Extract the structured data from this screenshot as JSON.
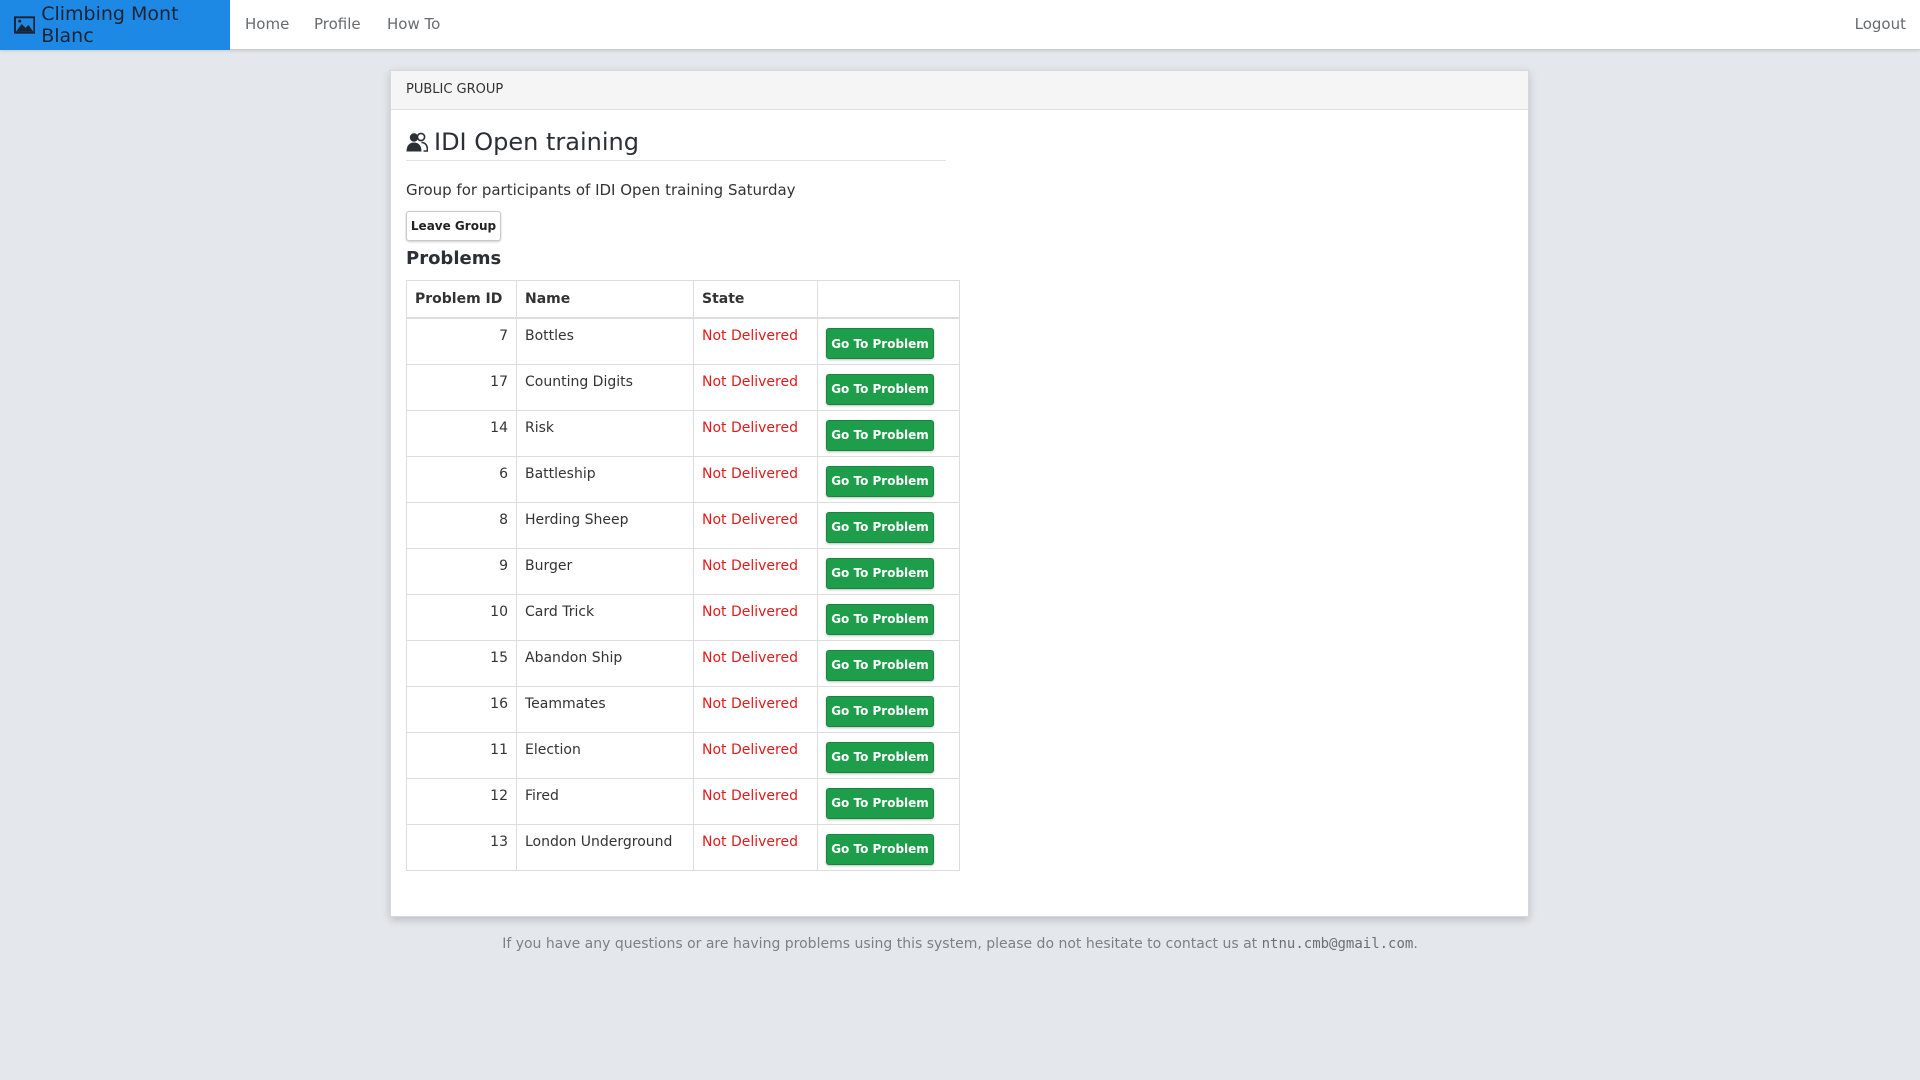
{
  "navbar": {
    "brand": "Climbing Mont Blanc",
    "brand_icon": "image-icon",
    "links": {
      "home": "Home",
      "profile": "Profile",
      "howto": "How To",
      "logout": "Logout"
    }
  },
  "panel": {
    "header": "PUBLIC GROUP",
    "title": "IDI Open training",
    "title_icon": "users-icon",
    "description": "Group for participants of IDI Open training Saturday",
    "leave_button": "Leave Group",
    "problems_heading": "Problems",
    "table": {
      "columns": [
        "Problem ID",
        "Name",
        "State",
        ""
      ],
      "action_label": "Go To Problem",
      "rows": [
        {
          "id": "7",
          "name": "Bottles",
          "state": "Not Delivered"
        },
        {
          "id": "17",
          "name": "Counting Digits",
          "state": "Not Delivered"
        },
        {
          "id": "14",
          "name": "Risk",
          "state": "Not Delivered"
        },
        {
          "id": "6",
          "name": "Battleship",
          "state": "Not Delivered"
        },
        {
          "id": "8",
          "name": "Herding Sheep",
          "state": "Not Delivered"
        },
        {
          "id": "9",
          "name": "Burger",
          "state": "Not Delivered"
        },
        {
          "id": "10",
          "name": "Card Trick",
          "state": "Not Delivered"
        },
        {
          "id": "15",
          "name": "Abandon Ship",
          "state": "Not Delivered"
        },
        {
          "id": "16",
          "name": "Teammates",
          "state": "Not Delivered"
        },
        {
          "id": "11",
          "name": "Election",
          "state": "Not Delivered"
        },
        {
          "id": "12",
          "name": "Fired",
          "state": "Not Delivered"
        },
        {
          "id": "13",
          "name": "London Underground",
          "state": "Not Delivered"
        }
      ]
    }
  },
  "footer": {
    "text": "If you have any questions or are having problems using this system, please do not hesitate to contact us at",
    "email": "ntnu.cmb@gmail.com",
    "end": "."
  },
  "colors": {
    "brand_bg": "#1e88e5",
    "page_bg": "#e4e7ec",
    "state_not_delivered": "#e01b1b",
    "action_button": "#1e9e4a"
  }
}
